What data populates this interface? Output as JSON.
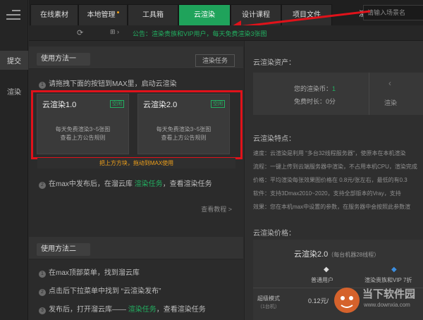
{
  "leftbar": {
    "items": [
      "提交",
      "渲染"
    ]
  },
  "tabs": [
    {
      "label": "在线素材",
      "active": false
    },
    {
      "label": "本地管理",
      "active": false
    },
    {
      "label": "工具箱",
      "active": false
    },
    {
      "label": "云渲染",
      "active": true
    },
    {
      "label": "设计课程",
      "active": false
    },
    {
      "label": "项目文件",
      "active": false
    },
    {
      "label": "渲染",
      "active": false
    }
  ],
  "search": {
    "placeholder": "请输入场景名"
  },
  "subbar": {
    "notice": "公告：渲染贵族和VIP用户，每天免费渲染3张图"
  },
  "method1": {
    "title": "使用方法一",
    "task_button": "渲染任务",
    "step1": "请拖拽下面的按钮到MAX里，启动云渲染",
    "cards": [
      {
        "title": "云渲染1.0",
        "badge": "空闲",
        "line1": "每天免费渲染3~5张图",
        "line2": "查看上方公告规则"
      },
      {
        "title": "云渲染2.0",
        "badge": "空闲",
        "line1": "每天免费渲染3~5张图",
        "line2": "查看上方公告规则"
      }
    ],
    "hint": "把上方方块，拖动到MAX使用",
    "step2_a": "在max中发布后，在溜云库",
    "step2_link": "渲染任务",
    "step2_b": "，查看渲染任务",
    "more": "查看教程 >"
  },
  "method2": {
    "title": "使用方法二",
    "step1": "在max顶部菜单，找到溜云库",
    "step2": "点击后下拉菜单中找到 “云渲染发布”",
    "step3_a": "发布后，打开溜云库——",
    "step3_link": "渲染任务",
    "step3_b": "，查看渲染任务"
  },
  "right": {
    "assets_title": "云渲染资产：",
    "coins_label": "您的渲染币：",
    "coins_value": "1",
    "free_label": "免费时长：",
    "free_value": "0分",
    "side_label": "渲染",
    "features_title": "云渲染特点：",
    "features": [
      "速度：云渲染是利用 “多台32线程服务器”，使原本在本机渲染",
      "流程：一键上传到云端服务器中渲染，不占用本机CPU，渲染完成",
      "价格：平均渲染每张效果图价格在 0.8元/张左右，最低的有0.3",
      "软件：支持3Dmax2010~2020，支持全部版本的Vray，支持",
      "效果：您在本机max中设置的参数，在服务器中会按照此参数渲"
    ],
    "price_title": "云渲染价格：",
    "price_product": "云渲染2.0",
    "price_product_note": "（每台机器28线程）",
    "price_col1": "普通用户",
    "price_col2": "渲染贵族和VIP 7折",
    "price_row_label": "超级模式",
    "price_row_sub": "（1台机）",
    "price_row_value": "0.12元/"
  },
  "watermark": {
    "brand": "当下软件园",
    "site": "www.downxia.com"
  }
}
